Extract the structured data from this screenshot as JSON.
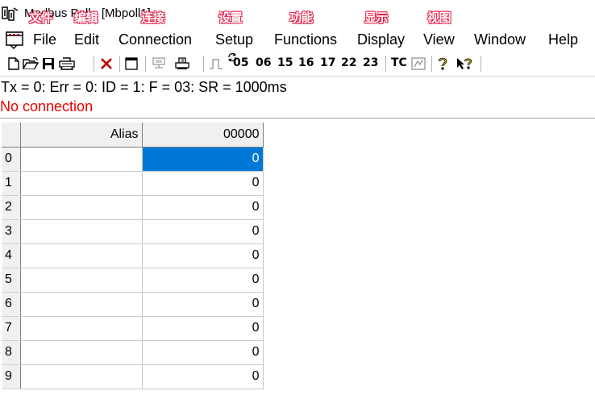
{
  "window": {
    "title": "Modbus Poll - [Mbpoll1]"
  },
  "annotations": [
    "文件",
    "编辑",
    "连接",
    "设置",
    "功能",
    "显示",
    "视图"
  ],
  "menu": {
    "items": [
      "File",
      "Edit",
      "Connection",
      "Setup",
      "Functions",
      "Display",
      "View",
      "Window",
      "Help"
    ]
  },
  "toolbar": {
    "function_codes": [
      "05",
      "06",
      "15",
      "16",
      "17",
      "22",
      "23"
    ],
    "tc_label": "TC",
    "icons": [
      "new-icon",
      "open-icon",
      "save-icon",
      "print-icon",
      "delete-icon",
      "window-icon",
      "connect-icon",
      "read-icon",
      "pulse-icon",
      "refresh-icon",
      "comm-traffic-icon",
      "help-icon",
      "context-help-icon"
    ]
  },
  "status": {
    "line1": "Tx = 0: Err = 0: ID = 1: F = 03: SR = 1000ms",
    "line2": "No connection",
    "line2_color": "#ee0000"
  },
  "grid": {
    "headers": [
      "Alias",
      "00000"
    ],
    "rows": [
      {
        "index": "0",
        "alias": "",
        "value": "0",
        "selected": true
      },
      {
        "index": "1",
        "alias": "",
        "value": "0"
      },
      {
        "index": "2",
        "alias": "",
        "value": "0"
      },
      {
        "index": "3",
        "alias": "",
        "value": "0"
      },
      {
        "index": "4",
        "alias": "",
        "value": "0"
      },
      {
        "index": "5",
        "alias": "",
        "value": "0"
      },
      {
        "index": "6",
        "alias": "",
        "value": "0"
      },
      {
        "index": "7",
        "alias": "",
        "value": "0"
      },
      {
        "index": "8",
        "alias": "",
        "value": "0"
      },
      {
        "index": "9",
        "alias": "",
        "value": "0"
      }
    ],
    "selected_color": "#0078d7"
  }
}
